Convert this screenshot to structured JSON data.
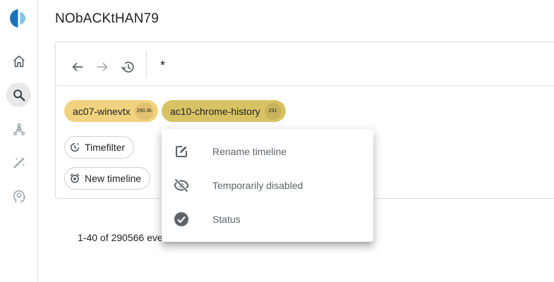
{
  "sketch": {
    "title": "NObACKtHAN79"
  },
  "rail": {
    "items": [
      {
        "icon": "home-icon"
      },
      {
        "icon": "search-icon",
        "active": true
      },
      {
        "icon": "graph-icon"
      },
      {
        "icon": "magic-wand-icon"
      },
      {
        "icon": "lightbulb-head-icon"
      }
    ]
  },
  "toolbar": {
    "back_icon": "arrow-back-icon",
    "forward_icon": "arrow-forward-icon",
    "history_icon": "history-icon"
  },
  "search": {
    "query": "*"
  },
  "timelines": [
    {
      "name": "ac07-winevtx",
      "count": "290.3k",
      "color": "#f1d27e"
    },
    {
      "name": "ac10-chrome-history",
      "count": "231",
      "color": "#d8c364"
    }
  ],
  "actions": {
    "timefilter_label": "Timefilter",
    "new_timeline_label": "New timeline"
  },
  "results": {
    "summary": "1-40 of 290566 eve"
  },
  "context_menu": {
    "items": [
      {
        "label": "Rename timeline",
        "icon": "edit-icon"
      },
      {
        "label": "Temporarily disabled",
        "icon": "visibility-off-icon"
      },
      {
        "label": "Status",
        "icon": "check-circle-icon"
      }
    ]
  }
}
